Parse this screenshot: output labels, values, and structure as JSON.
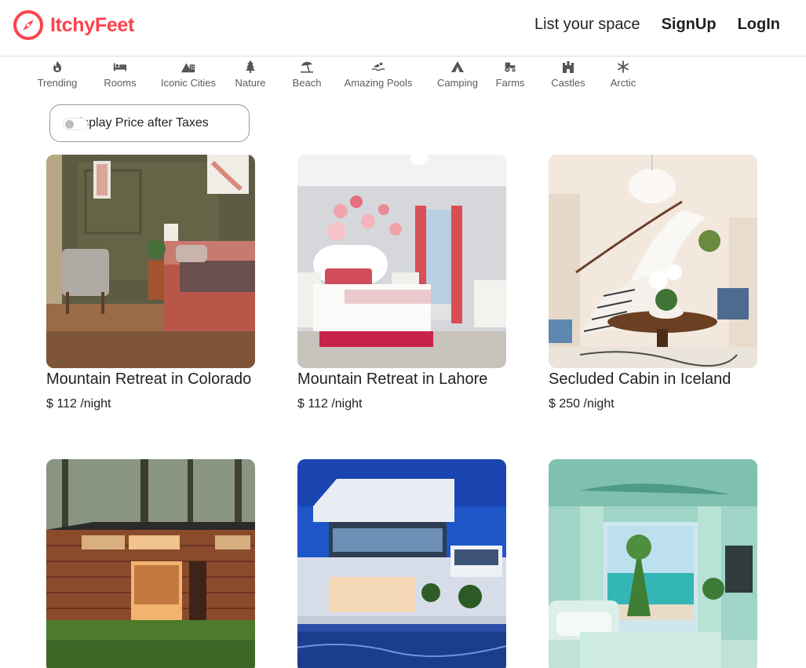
{
  "brand": {
    "name": "ItchyFeet",
    "icon": "compass-icon",
    "color": "#fe424d"
  },
  "nav": {
    "list_space": "List your space",
    "signup": "SignUp",
    "login": "LogIn"
  },
  "filters": [
    {
      "label": "Trending",
      "icon": "fire-icon"
    },
    {
      "label": "Rooms",
      "icon": "bed-icon"
    },
    {
      "label": "Iconic Cities",
      "icon": "mountain-city-icon"
    },
    {
      "label": "Nature",
      "icon": "tree-icon"
    },
    {
      "label": "Beach",
      "icon": "umbrella-beach-icon"
    },
    {
      "label": "Amazing Pools",
      "icon": "person-swimming-icon"
    },
    {
      "label": "Camping",
      "icon": "campground-icon"
    },
    {
      "label": "Farms",
      "icon": "tractor-icon"
    },
    {
      "label": "Castles",
      "icon": "castle-icon"
    },
    {
      "label": "Arctic",
      "icon": "snowflake-icon"
    }
  ],
  "tax_toggle": {
    "label": "Display Price after Taxes",
    "checked": false
  },
  "listings": [
    {
      "title": "Mountain Retreat in Colorado",
      "currency": "$",
      "price": "112",
      "unit": "/night",
      "image": "modern-bedroom-olive-walls"
    },
    {
      "title": "Mountain Retreat in Lahore",
      "currency": "$",
      "price": "112",
      "unit": "/night",
      "image": "bedroom-floral-wall-decor"
    },
    {
      "title": "Secluded Cabin in Iceland",
      "currency": "$",
      "price": "250",
      "unit": "/night",
      "image": "grand-staircase-chandelier"
    },
    {
      "title": "",
      "currency": "",
      "price": "",
      "unit": "",
      "image": "tiny-wooden-cabin-forest"
    },
    {
      "title": "",
      "currency": "",
      "price": "",
      "unit": "",
      "image": "modern-villa-pool-night"
    },
    {
      "title": "",
      "currency": "",
      "price": "",
      "unit": "",
      "image": "mint-bedroom-ocean-view"
    }
  ]
}
